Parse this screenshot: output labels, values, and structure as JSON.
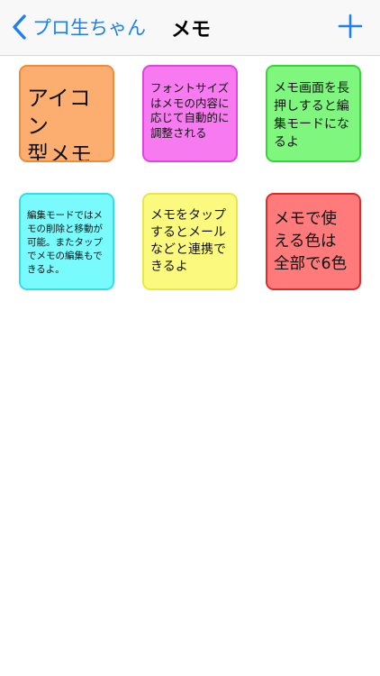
{
  "nav": {
    "back_label": "プロ生ちゃん",
    "title": "メモ",
    "back_icon": "chevron-left-icon",
    "add_icon": "plus-icon",
    "accent_color": "#1e80f0"
  },
  "memos": [
    {
      "text": "アイコン\n型メモ",
      "color": "orange"
    },
    {
      "text": "フォントサイズ\nはメモの内容に\n応じて自動的に\n調整される",
      "color": "pink"
    },
    {
      "text": "メモ画面を長\n押しすると編\n集モードにな\nるよ",
      "color": "green"
    },
    {
      "text": "編集モードではメ\nモの削除と移動が\n可能。またタップ\nでメモの編集もで\nきるよ。",
      "color": "cyan"
    },
    {
      "text": "メモをタップ\nするとメール\nなどと連携で\nきるよ",
      "color": "yellow"
    },
    {
      "text": "メモで使\nえる色は\n全部で6色",
      "color": "red"
    }
  ]
}
